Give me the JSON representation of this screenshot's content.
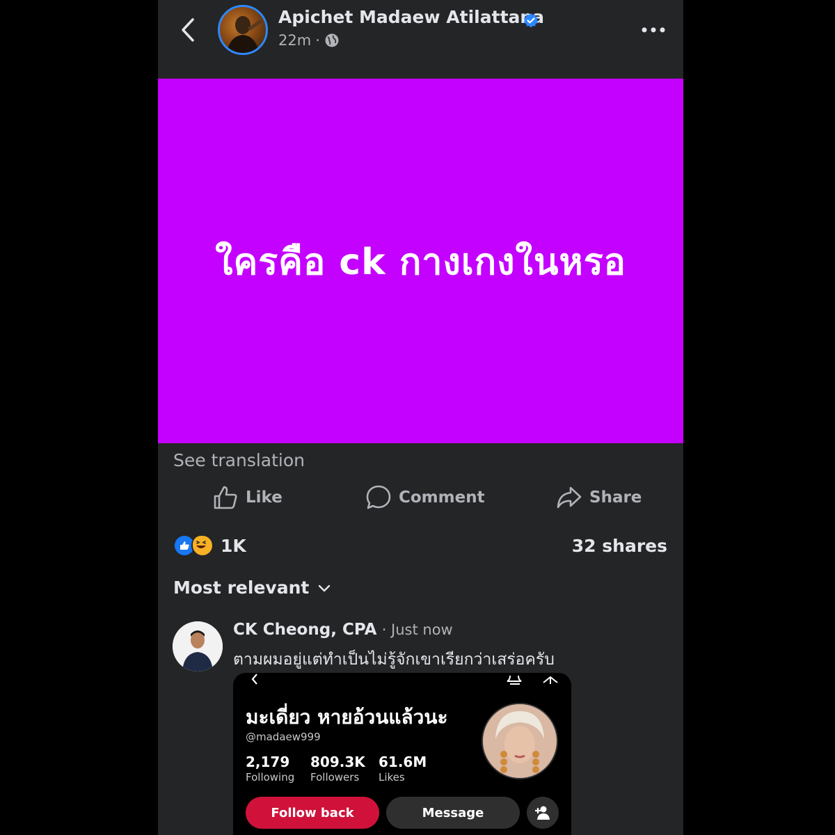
{
  "post": {
    "author": "Apichet Madaew Atilattana",
    "time": "22m",
    "separator": "·",
    "image_text": "ใครคือ ck กางเกงในหรอ",
    "image_bg": "#c400ff",
    "see_translation": "See translation"
  },
  "actions": {
    "like": "Like",
    "comment": "Comment",
    "share": "Share"
  },
  "stats": {
    "reactions": "1K",
    "shares": "32 shares"
  },
  "sort": {
    "label": "Most relevant"
  },
  "comment": {
    "author": "CK Cheong, CPA",
    "time": "· Just now",
    "text": "ตามผมอยู่แต่ทำเป็นไม่รู้จักเขาเรียกว่าเสร่อครับ"
  },
  "embed": {
    "name": "มะเดี่ยว หายอ้วนแล้วนะ",
    "handle": "@madaew999",
    "stats": [
      {
        "value": "2,179",
        "label": "Following"
      },
      {
        "value": "809.3K",
        "label": "Followers"
      },
      {
        "value": "61.6M",
        "label": "Likes"
      }
    ],
    "follow_back": "Follow back",
    "message": "Message"
  },
  "colors": {
    "background": "#242526",
    "accent": "#1877f2",
    "follow": "#d0123a"
  }
}
